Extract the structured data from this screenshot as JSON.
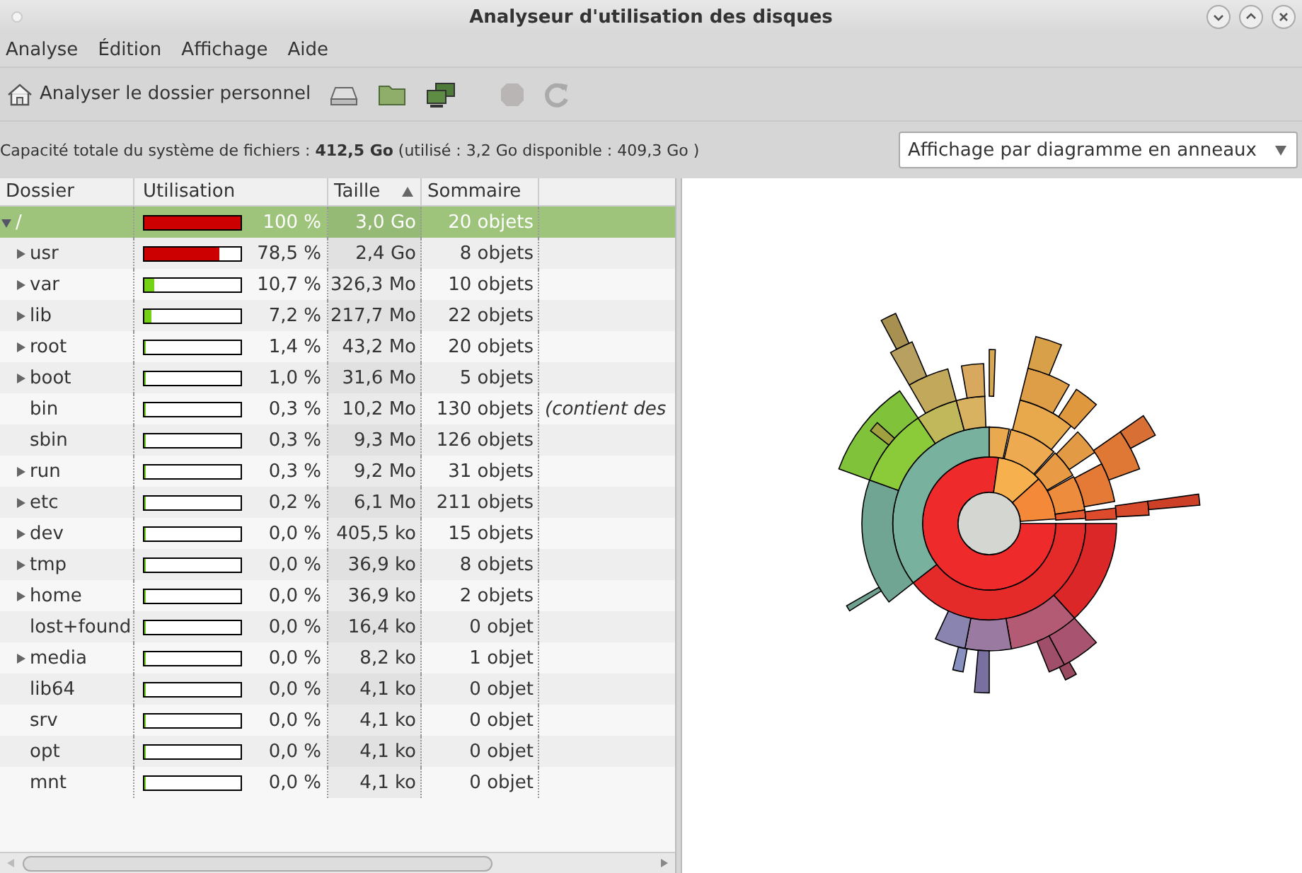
{
  "window": {
    "title": "Analyseur d'utilisation des disques"
  },
  "menu": [
    "Analyse",
    "Édition",
    "Affichage",
    "Aide"
  ],
  "toolbar": {
    "home_button": "Analyser le dossier personnel",
    "stop_disabled": true
  },
  "info": "Capacité totale du système de fichiers : **412,5 Go** (utilisé : 3,2 Go disponible : 409,3 Go )",
  "view_select": {
    "value": "Affichage par diagramme en anneaux"
  },
  "table": {
    "columns": [
      {
        "label": "Dossier",
        "sorted": false
      },
      {
        "label": "Utilisation",
        "sorted": false
      },
      {
        "label": "Taille",
        "sorted": true
      },
      {
        "label": "Sommaire",
        "sorted": false
      }
    ],
    "rows": [
      {
        "name": "/",
        "expanded": true,
        "selected": true,
        "level": 1.0,
        "percent": "100 %",
        "size": "3,0 Go",
        "summary": "20 objets",
        "children": [
          {
            "name": "usr",
            "expanded": false,
            "selected": false,
            "level": 0.785,
            "percent": "78,5 %",
            "size": "2,4 Go",
            "summary": "8 objets"
          },
          {
            "name": "var",
            "expanded": false,
            "selected": false,
            "level": 0.107,
            "percent": "10,7 %",
            "size": "326,3 Mo",
            "summary": "10 objets"
          },
          {
            "name": "lib",
            "expanded": false,
            "selected": false,
            "level": 0.072,
            "percent": "7,2 %",
            "size": "217,7 Mo",
            "summary": "22 objets"
          },
          {
            "name": "root",
            "expanded": false,
            "selected": false,
            "level": 0.014,
            "percent": "1,4 %",
            "size": "43,2 Mo",
            "summary": "20 objets"
          },
          {
            "name": "boot",
            "expanded": false,
            "selected": false,
            "level": 0.01,
            "percent": "1,0 %",
            "size": "31,6 Mo",
            "summary": "5 objets"
          },
          {
            "name": "bin",
            "selected": false,
            "level": 0.003,
            "percent": "0,3 %",
            "size": "10,2 Mo",
            "summary": "130 objets",
            "note": "(contient des"
          },
          {
            "name": "sbin",
            "selected": false,
            "level": 0.003,
            "percent": "0,3 %",
            "size": "9,3 Mo",
            "summary": "126 objets"
          },
          {
            "name": "run",
            "expanded": false,
            "selected": false,
            "level": 0.003,
            "percent": "0,3 %",
            "size": "9,2 Mo",
            "summary": "31 objets"
          },
          {
            "name": "etc",
            "expanded": false,
            "selected": false,
            "level": 0.002,
            "percent": "0,2 %",
            "size": "6,1 Mo",
            "summary": "211 objets"
          },
          {
            "name": "dev",
            "expanded": false,
            "selected": false,
            "level": 0.0,
            "percent": "0,0 %",
            "size": "405,5 ko",
            "summary": "15 objets"
          },
          {
            "name": "tmp",
            "expanded": false,
            "selected": false,
            "level": 0.0,
            "percent": "0,0 %",
            "size": "36,9 ko",
            "summary": "8 objets"
          },
          {
            "name": "home",
            "expanded": false,
            "selected": false,
            "level": 0.0,
            "percent": "0,0 %",
            "size": "36,9 ko",
            "summary": "2 objets"
          },
          {
            "name": "lost+found",
            "selected": false,
            "level": 0.0,
            "percent": "0,0 %",
            "size": "16,4 ko",
            "summary": "0 objet"
          },
          {
            "name": "media",
            "expanded": false,
            "selected": false,
            "level": 0.0,
            "percent": "0,0 %",
            "size": "8,2 ko",
            "summary": "1 objet"
          },
          {
            "name": "lib64",
            "selected": false,
            "level": 0.0,
            "percent": "0,0 %",
            "size": "4,1 ko",
            "summary": "0 objet"
          },
          {
            "name": "srv",
            "selected": false,
            "level": 0.0,
            "percent": "0,0 %",
            "size": "4,1 ko",
            "summary": "0 objet"
          },
          {
            "name": "opt",
            "selected": false,
            "level": 0.0,
            "percent": "0,0 %",
            "size": "4,1 ko",
            "summary": "0 objet"
          },
          {
            "name": "mnt",
            "selected": false,
            "level": 0.0,
            "percent": "0,0 %",
            "size": "4,1 ko",
            "summary": "0 objet"
          }
        ]
      }
    ]
  }
}
